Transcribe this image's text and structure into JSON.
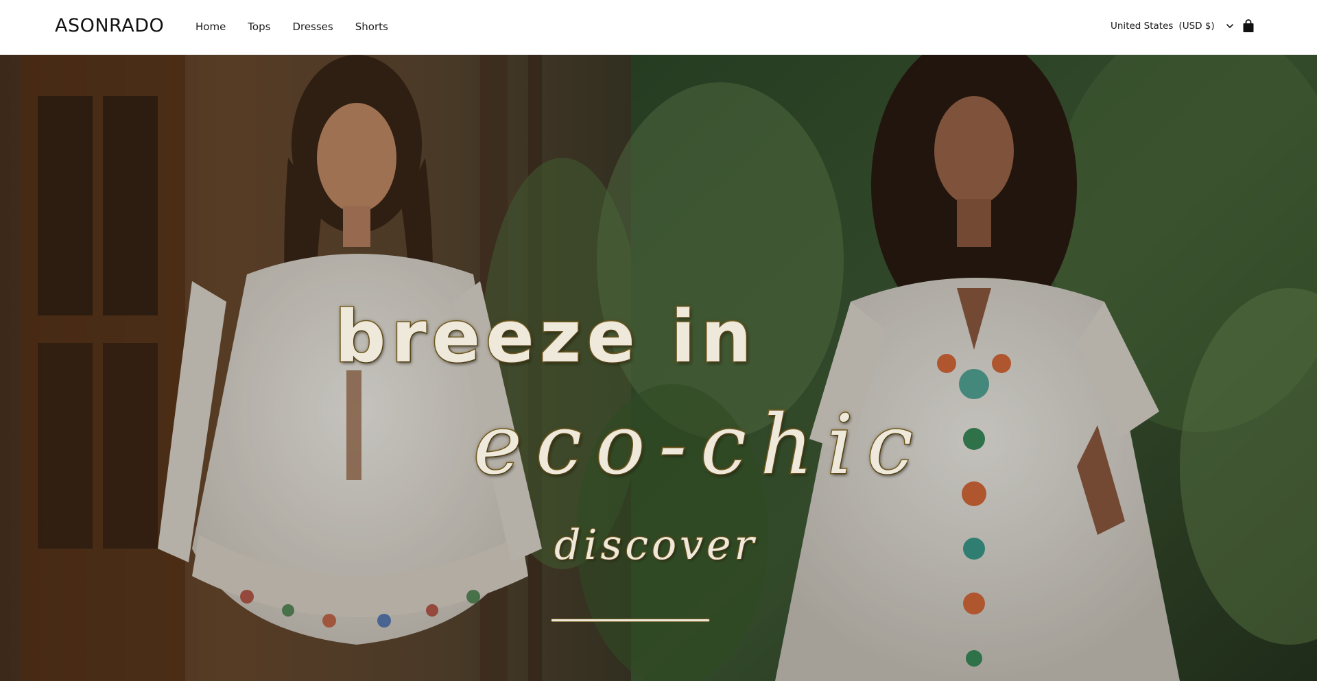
{
  "header": {
    "logo_text": "ASONRADO",
    "nav": [
      {
        "label": "Home"
      },
      {
        "label": "Tops"
      },
      {
        "label": "Dresses"
      },
      {
        "label": "Shorts"
      }
    ],
    "locale": {
      "country": "United States",
      "currency": "(USD $)",
      "icon": "chevron-down-icon"
    },
    "cart_icon": "shopping-bag-icon"
  },
  "hero": {
    "headline": "breeze in",
    "subheadline": "eco-chic",
    "cta_label": "discover",
    "image_subject": "two women in white floral-embroidered dresses in a tropical garden"
  },
  "colors": {
    "header_bg": "#ffffff",
    "text": "#111111",
    "hero_text_fill": "#efe9dc",
    "hero_text_outline": "#7a6326"
  }
}
